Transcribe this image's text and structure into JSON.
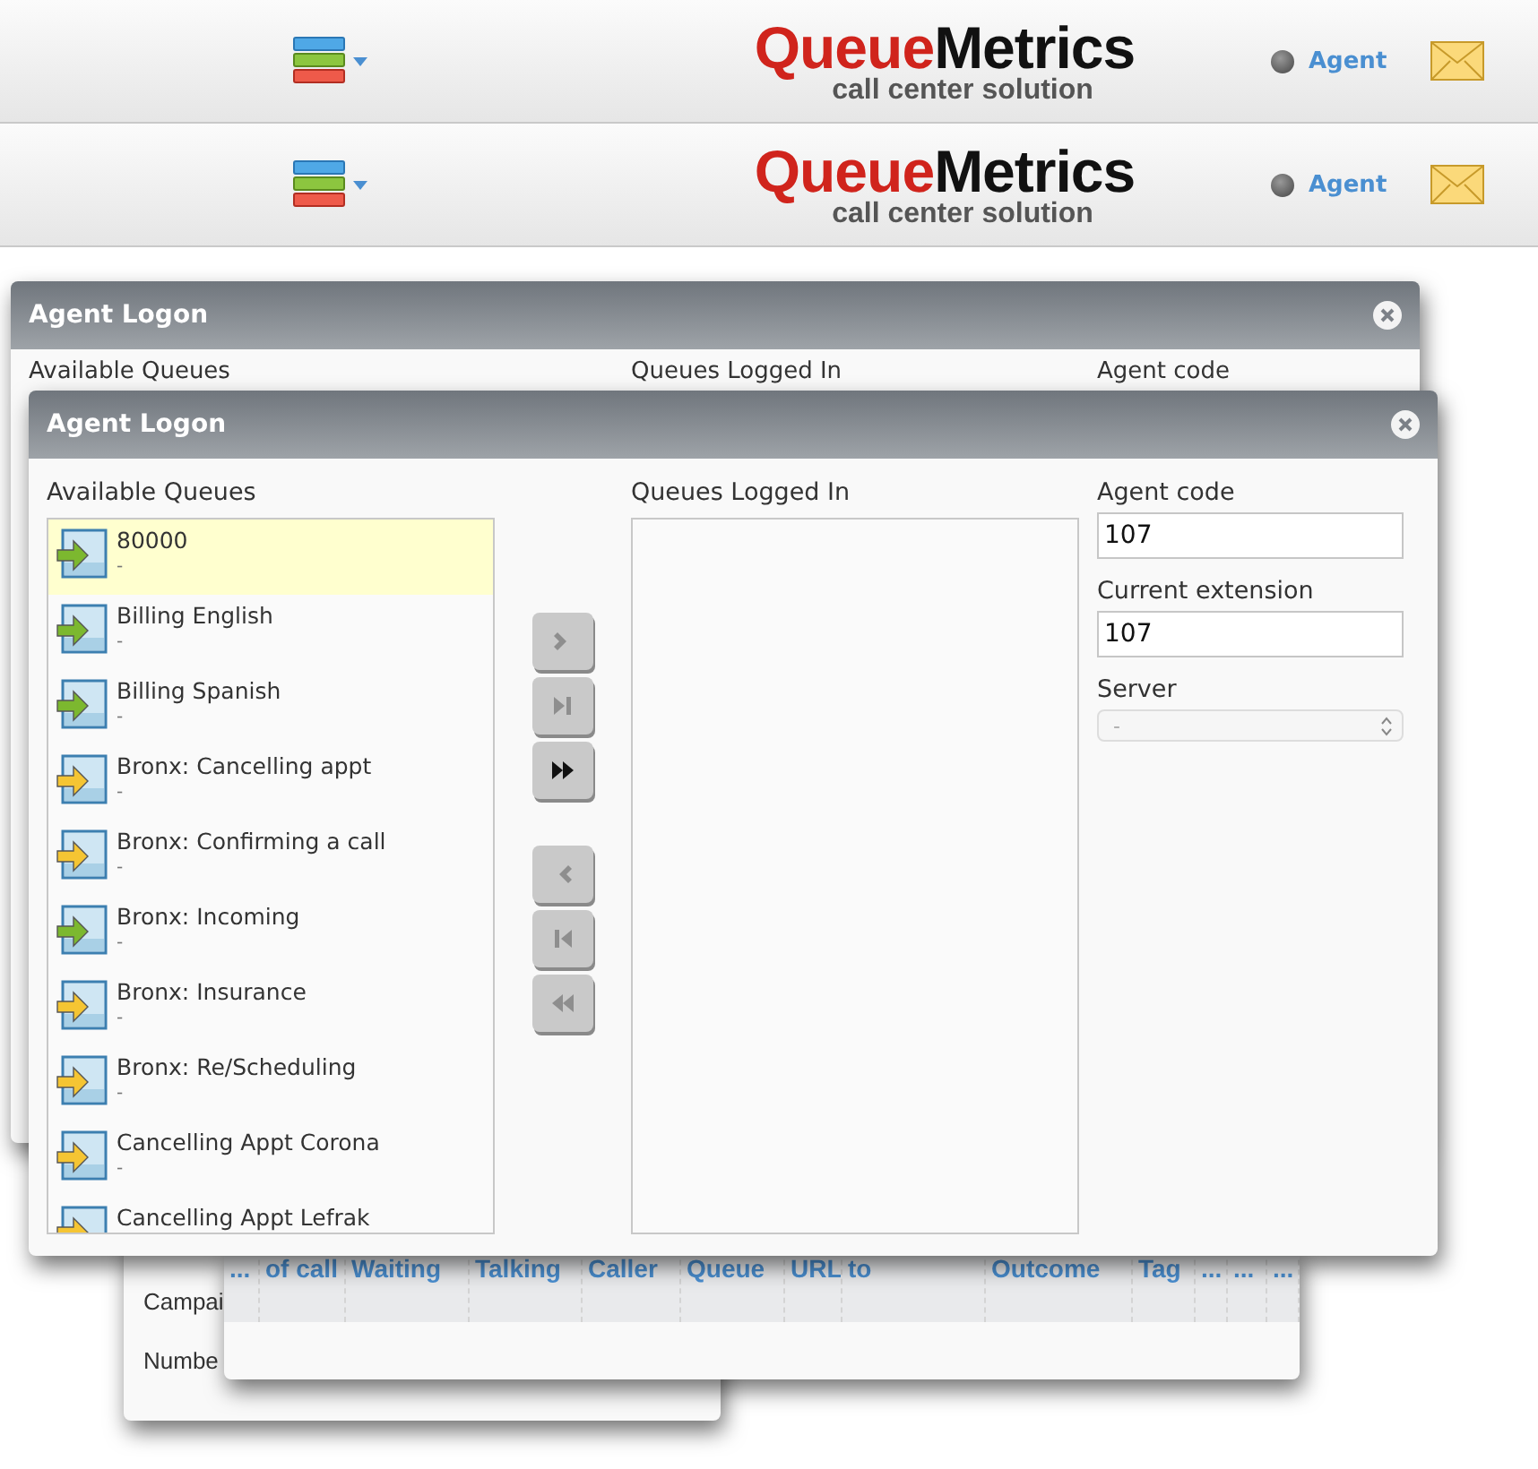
{
  "headers": [
    {
      "logo": {
        "first": "Queue",
        "second": "Metrics",
        "tagline": "call center solution"
      },
      "user_link": "Agent"
    },
    {
      "logo": {
        "first": "Queue",
        "second": "Metrics",
        "tagline": "call center solution"
      },
      "user_link": "Agent"
    }
  ],
  "back_logon_window": {
    "title": "Agent Logon",
    "labels": [
      "Available Queues",
      "Queues Logged In",
      "Agent code"
    ]
  },
  "campaign_window": {
    "labels": [
      "Campai",
      "Numbe"
    ]
  },
  "table_window": {
    "columns": [
      "...",
      "of call",
      "Waiting",
      "Talking",
      "Caller",
      "Queue",
      "URL",
      "to",
      "Outcome",
      "Tag",
      "...",
      "...",
      "..."
    ]
  },
  "dialog": {
    "title": "Agent Logon",
    "available_label": "Available Queues",
    "available_queues": [
      {
        "name": "80000",
        "detail": "-",
        "color": "#7cb82f",
        "selected": true
      },
      {
        "name": "Billing English",
        "detail": "-",
        "color": "#7cb82f",
        "selected": false
      },
      {
        "name": "Billing Spanish",
        "detail": "-",
        "color": "#7cb82f",
        "selected": false
      },
      {
        "name": "Bronx: Cancelling appt",
        "detail": "-",
        "color": "#f5c533",
        "selected": false
      },
      {
        "name": "Bronx: Confirming a call",
        "detail": "-",
        "color": "#f5c533",
        "selected": false
      },
      {
        "name": "Bronx: Incoming",
        "detail": "-",
        "color": "#7cb82f",
        "selected": false
      },
      {
        "name": "Bronx: Insurance",
        "detail": "-",
        "color": "#f5c533",
        "selected": false
      },
      {
        "name": "Bronx: Re/Scheduling",
        "detail": "-",
        "color": "#f5c533",
        "selected": false
      },
      {
        "name": "Cancelling Appt Corona",
        "detail": "-",
        "color": "#f5c533",
        "selected": false
      },
      {
        "name": "Cancelling Appt Lefrak",
        "color": "#f5c533",
        "selected": false
      }
    ],
    "move_buttons": [
      {
        "kind": "add",
        "disabled": true
      },
      {
        "kind": "add_last",
        "disabled": true
      },
      {
        "kind": "add_all",
        "disabled": false
      },
      {
        "kind": "remove",
        "disabled": true
      },
      {
        "kind": "remove_first",
        "disabled": true
      },
      {
        "kind": "remove_all",
        "disabled": true
      }
    ],
    "logged_label": "Queues Logged In",
    "fields": [
      {
        "kind": "text",
        "label": "Agent code",
        "value": "107"
      },
      {
        "kind": "text",
        "label": "Current extension",
        "value": "107"
      },
      {
        "kind": "select",
        "label": "Server",
        "value": "-",
        "disabled": true
      }
    ]
  }
}
